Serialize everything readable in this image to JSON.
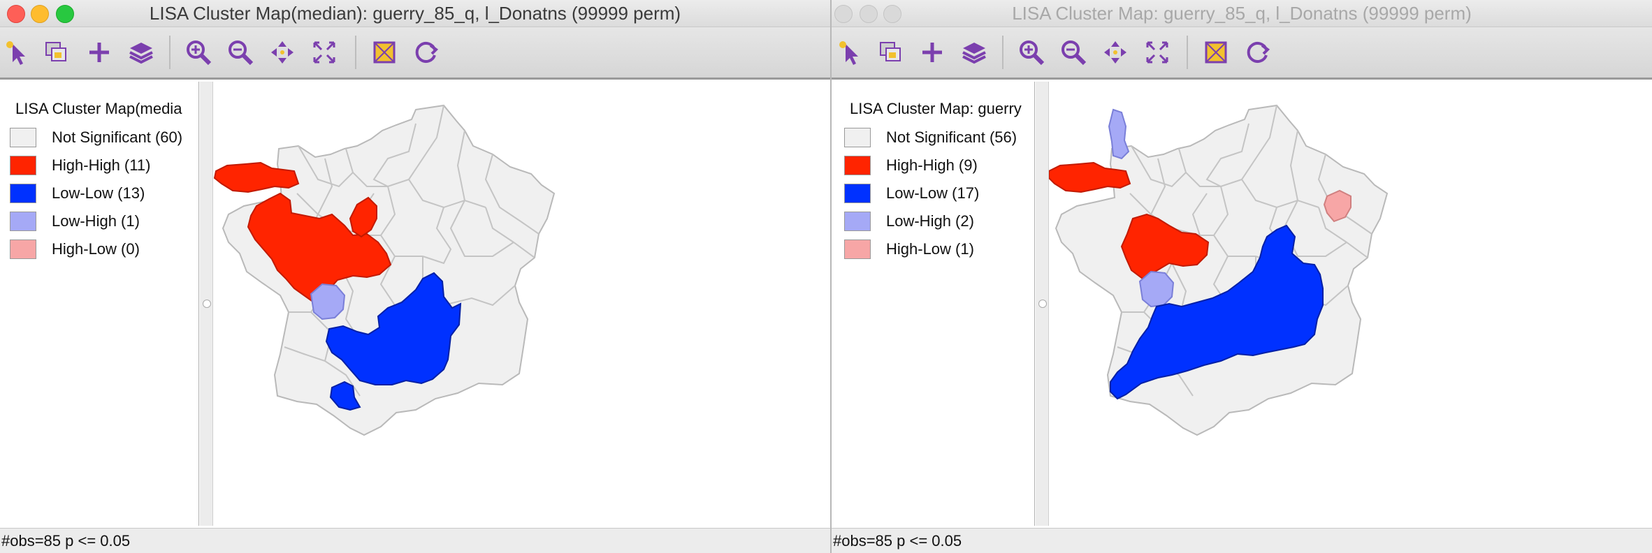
{
  "windows": [
    {
      "title": "LISA Cluster Map(median): guerry_85_q, l_Donatns (99999 perm)",
      "legend_title": "LISA Cluster Map(media",
      "legend": [
        {
          "label": "Not Significant (60)",
          "color": "#f0f0f0"
        },
        {
          "label": "High-High (11)",
          "color": "#ff2400"
        },
        {
          "label": "Low-Low (13)",
          "color": "#0031ff"
        },
        {
          "label": "Low-High (1)",
          "color": "#a5a9f6"
        },
        {
          "label": "High-Low (0)",
          "color": "#f7a6a6"
        }
      ],
      "status": "#obs=85  p <= 0.05",
      "active": true
    },
    {
      "title": "LISA Cluster Map: guerry_85_q, l_Donatns (99999 perm)",
      "legend_title": "LISA Cluster Map: guerry",
      "legend": [
        {
          "label": "Not Significant (56)",
          "color": "#f0f0f0"
        },
        {
          "label": "High-High (9)",
          "color": "#ff2400"
        },
        {
          "label": "Low-Low (17)",
          "color": "#0031ff"
        },
        {
          "label": "Low-High (2)",
          "color": "#a5a9f6"
        },
        {
          "label": "High-Low (1)",
          "color": "#f7a6a6"
        }
      ],
      "status": "#obs=85  p <= 0.05",
      "active": false
    }
  ],
  "toolbar": [
    "select-pointer-icon",
    "copy-image-icon",
    "add-icon",
    "layers-icon",
    "zoom-in-icon",
    "zoom-out-icon",
    "pan-icon",
    "fit-extent-icon",
    "selection-mode-icon",
    "refresh-icon"
  ],
  "colors": {
    "accent_icon": "#7b3fae",
    "high_high": "#ff2400",
    "low_low": "#0031ff",
    "low_high": "#a5a9f6",
    "high_low": "#f7a6a6",
    "not_sig": "#f0f0f0"
  }
}
